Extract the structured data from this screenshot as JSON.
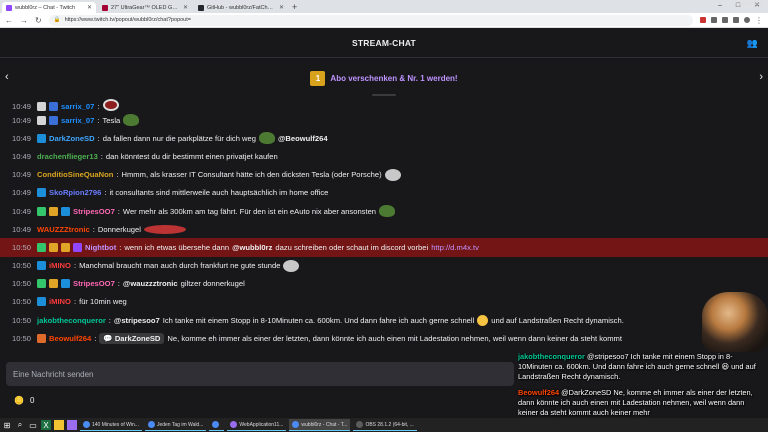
{
  "browser": {
    "tabs": [
      {
        "label": "wubbl0rz – Chat - Twitch",
        "active": true,
        "color": "#9147ff"
      },
      {
        "label": "27\" UltraGear™ OLED Gaming M...",
        "active": false,
        "color": "#a50034"
      },
      {
        "label": "GitHub - wubbl0rz/FatChamp: F...",
        "active": false,
        "color": "#24292f"
      }
    ],
    "new_tab": "+",
    "url": "https://www.twitch.tv/popout/wubbl0rz/chat?popout=",
    "window_controls": [
      "–",
      "□",
      "✕"
    ]
  },
  "header": {
    "title": "STREAM-CHAT",
    "users_icon": "users-icon"
  },
  "gift_banner": {
    "badge": "1",
    "text": "Abo verschenken & Nr. 1 werden!"
  },
  "messages": [
    {
      "ts": "10:49",
      "badges": [
        "#d4d4d4",
        "#3a6fd8"
      ],
      "user": "sarrix_07",
      "color": "#1e90ff",
      "parts": [
        {
          "t": "emote",
          "v": "red"
        }
      ]
    },
    {
      "ts": "10:49",
      "badges": [
        "#d4d4d4",
        "#3a6fd8"
      ],
      "user": "sarrix_07",
      "color": "#1e90ff",
      "parts": [
        {
          "t": "text",
          "v": "Tesla"
        },
        {
          "t": "emote",
          "v": "pepe"
        }
      ]
    },
    {
      "ts": "10:49",
      "badges": [
        "#1c8fdb"
      ],
      "user": "DarkZoneSD",
      "color": "#3ea7ff",
      "parts": [
        {
          "t": "text",
          "v": "da fallen dann nur die parkplätze für dich weg"
        },
        {
          "t": "emote",
          "v": "pepe"
        },
        {
          "t": "mention",
          "v": "@Beowulf264"
        }
      ]
    },
    {
      "ts": "10:49",
      "badges": [],
      "user": "drachenflieger13",
      "color": "#4caf50",
      "parts": [
        {
          "t": "text",
          "v": "dan könntest du dir bestimmt einen privatjet kaufen"
        }
      ]
    },
    {
      "ts": "10:49",
      "badges": [],
      "user": "ConditioSineQuaNon",
      "color": "#daa520",
      "parts": [
        {
          "t": "text",
          "v": "Hmmm, als krasser IT Consultant hätte ich den dicksten Tesla (oder Porsche)"
        },
        {
          "t": "emote",
          "v": "face"
        }
      ]
    },
    {
      "ts": "10:49",
      "badges": [
        "#1c8fdb"
      ],
      "user": "SkoRpion2796",
      "color": "#6a7dff",
      "parts": [
        {
          "t": "text",
          "v": "it consultants sind mittlerweile auch hauptsächlich im home office"
        }
      ]
    },
    {
      "ts": "10:49",
      "badges": [
        "#34c66b",
        "#e0a527",
        "#1c8fdb"
      ],
      "user": "StripesOO7",
      "color": "#ff69b4",
      "parts": [
        {
          "t": "text",
          "v": "Wer mehr als 300km am tag fährt. Für den ist ein eAuto nix aber ansonsten"
        },
        {
          "t": "emote",
          "v": "pepe"
        }
      ]
    },
    {
      "ts": "10:49",
      "badges": [],
      "user": "WAUZZZtronic",
      "color": "#ff4500",
      "parts": [
        {
          "t": "text",
          "v": "Donnerkugel"
        },
        {
          "t": "emote",
          "v": "ball"
        }
      ]
    },
    {
      "ts": "10:50",
      "badges": [
        "#34c66b",
        "#e0a527",
        "#e0a527",
        "#9147ff"
      ],
      "user": "Nightbot",
      "color": "#bf94ff",
      "highlight": true,
      "parts": [
        {
          "t": "text",
          "v": "wenn ich etwas übersehe dann"
        },
        {
          "t": "mention",
          "v": "@wubbl0rz"
        },
        {
          "t": "text",
          "v": "dazu schreiben oder schaut im discord vorbei"
        },
        {
          "t": "link",
          "v": "http://d.m4x.tv"
        }
      ]
    },
    {
      "ts": "10:50",
      "badges": [
        "#1c8fdb"
      ],
      "user": "iMINO",
      "color": "#ff3b3b",
      "parts": [
        {
          "t": "text",
          "v": "Manchmal braucht man auch durch frankfurt ne gute stunde"
        },
        {
          "t": "emote",
          "v": "face"
        }
      ]
    },
    {
      "ts": "10:50",
      "badges": [
        "#34c66b",
        "#e0a527",
        "#1c8fdb"
      ],
      "user": "StripesOO7",
      "color": "#ff69b4",
      "parts": [
        {
          "t": "mention",
          "v": "@wauzzztronic"
        },
        {
          "t": "text",
          "v": "giltzer donnerkugel"
        }
      ]
    },
    {
      "ts": "10:50",
      "badges": [
        "#1c8fdb"
      ],
      "user": "iMINO",
      "color": "#ff3b3b",
      "parts": [
        {
          "t": "text",
          "v": "für 10min weg"
        }
      ]
    },
    {
      "ts": "10:50",
      "badges": [],
      "user": "jakobtheconqueror",
      "color": "#00c896",
      "parts": [
        {
          "t": "mention",
          "v": "@stripesoo7"
        },
        {
          "t": "text",
          "v": "Ich tanke mit einem Stopp in 8-10Minuten ca. 600km. Und dann fahre ich auch gerne schnell"
        },
        {
          "t": "emote",
          "v": "laugh"
        },
        {
          "t": "text",
          "v": "und auf Landstraßen Recht dynamisch."
        }
      ]
    },
    {
      "ts": "10:50",
      "badges": [
        "#e06a2a"
      ],
      "user": "Beowulf264",
      "color": "#ff4500",
      "parts": [
        {
          "t": "mentionbox",
          "v": "DarkZoneSD"
        },
        {
          "t": "text",
          "v": "Ne, komme eh immer als einer der letzten, dann könnte ich auch einen mit Ladestation nehmen, weil wenn dann keiner da steht kommt"
        }
      ]
    }
  ],
  "chat_input": {
    "placeholder": "Eine Nachricht senden"
  },
  "points": {
    "value": "0"
  },
  "overlay": [
    {
      "user": "jakobtheconqueror",
      "color": "#00c896",
      "text": "@stripesoo7 Ich tanke mit einem Stopp in 8-10Minuten ca. 600km. Und dann fahre ich auch gerne schnell 😆 und auf Landstraßen Recht dynamisch."
    },
    {
      "user": "Beowulf264",
      "color": "#ff4500",
      "text": "@DarkZoneSD Ne, komme eh immer als einer der letzten, dann könnte ich auch einen mit Ladestation nehmen, weil wenn dann keiner da steht kommt auch keiner mehr"
    }
  ],
  "taskbar": {
    "items": [
      {
        "label": "140 Minutes of Win...",
        "color": "#4a8bf5"
      },
      {
        "label": "Jeden Tag im Wald...",
        "color": "#4a8bf5"
      },
      {
        "label": "",
        "color": "#4a8bf5"
      },
      {
        "label": "WebApplication11...",
        "color": "#9a6cf0"
      },
      {
        "label": "wubbl0rz - Chat - T...",
        "color": "#4a8bf5",
        "active": true
      },
      {
        "label": "OBS 28.1.2 (64-bit, ...",
        "color": "#5c5c5c"
      }
    ],
    "clock_time": "",
    "clock_date": "18/12/2022"
  }
}
